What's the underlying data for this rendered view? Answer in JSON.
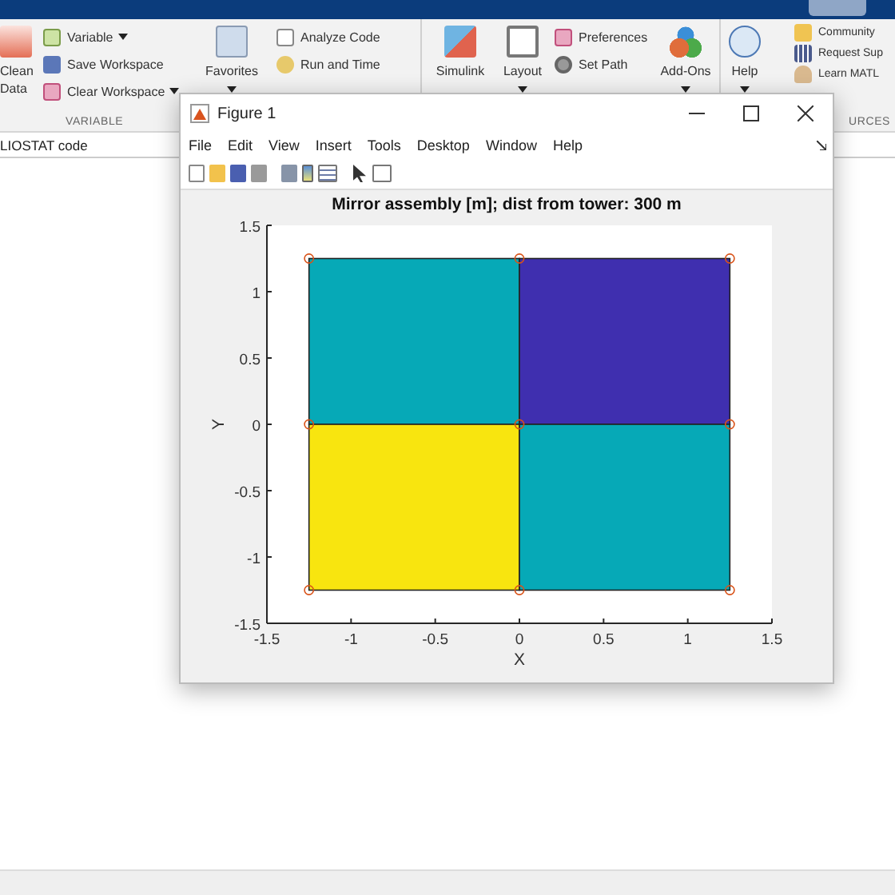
{
  "ribbon": {
    "groups": [
      {
        "kind": "large",
        "label": "Clean Data",
        "dropdown": false
      },
      {
        "kind": "stack",
        "section": "VARIABLE",
        "items": [
          {
            "label": "Variable",
            "dropdown": true
          },
          {
            "label": "Save Workspace",
            "dropdown": false
          },
          {
            "label": "Clear Workspace",
            "dropdown": true
          }
        ]
      },
      {
        "kind": "large",
        "label": "Favorites",
        "dropdown": true
      },
      {
        "kind": "stack",
        "items": [
          {
            "label": "Analyze Code",
            "dropdown": false
          },
          {
            "label": "Run and Time",
            "dropdown": false
          }
        ]
      },
      {
        "kind": "large",
        "label": "Simulink",
        "dropdown": false
      },
      {
        "kind": "large",
        "label": "Layout",
        "dropdown": true
      },
      {
        "kind": "stack",
        "items": [
          {
            "label": "Preferences",
            "dropdown": false
          },
          {
            "label": "Set Path",
            "dropdown": false
          }
        ]
      },
      {
        "kind": "large",
        "label": "Add-Ons",
        "dropdown": true
      },
      {
        "kind": "large",
        "label": "Help",
        "dropdown": true
      },
      {
        "kind": "stack",
        "section": "URCES",
        "items": [
          {
            "label": "Community"
          },
          {
            "label": "Request Sup"
          },
          {
            "label": "Learn MATL"
          }
        ]
      }
    ]
  },
  "address": "LIOSTAT code",
  "figure": {
    "title": "Figure 1",
    "menu": [
      "File",
      "Edit",
      "View",
      "Insert",
      "Tools",
      "Desktop",
      "Window",
      "Help"
    ],
    "chart_data": {
      "type": "scatter",
      "title": "Mirror assembly [m]; dist from tower: 300 m",
      "xlabel": "X",
      "ylabel": "Y",
      "x": [
        -1.25,
        0,
        1.25,
        -1.25,
        0,
        1.25,
        -1.25,
        0,
        1.25
      ],
      "series": [
        {
          "color": "#d95319",
          "values": [
            1.25,
            1.25,
            1.25,
            0,
            0,
            0,
            -1.25,
            -1.25,
            -1.25
          ]
        }
      ],
      "xlim": [
        -1.5,
        1.5
      ],
      "ylim": [
        -1.5,
        1.5
      ],
      "xticks": [
        -1.5,
        -1,
        -0.5,
        0,
        0.5,
        1,
        1.5
      ],
      "yticks": [
        -1.5,
        -1,
        -0.5,
        0,
        0.5,
        1,
        1.5
      ]
    },
    "patches": [
      {
        "color": "#06a9b7"
      },
      {
        "color": "#3f2faf"
      },
      {
        "color": "#f8e50f"
      },
      {
        "color": "#06a9b7"
      }
    ]
  }
}
